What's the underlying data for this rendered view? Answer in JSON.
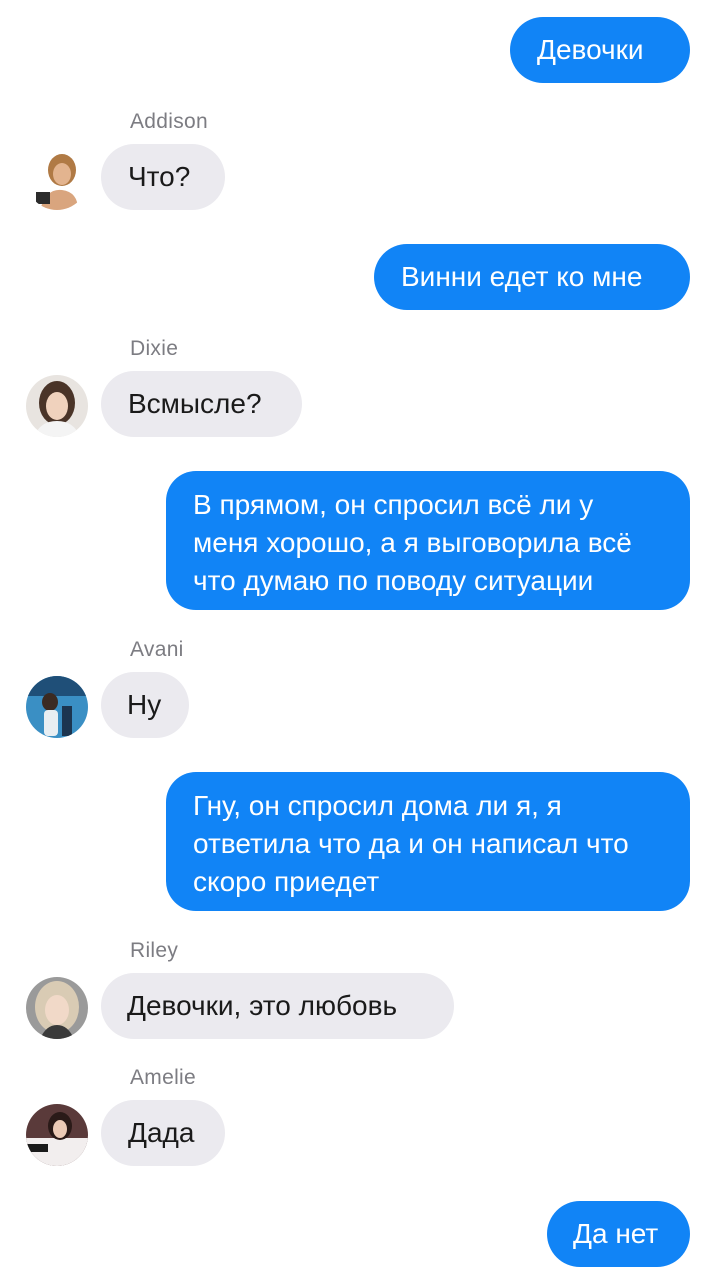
{
  "chat": {
    "messages": [
      {
        "sender": "me",
        "text": "Девочки"
      },
      {
        "sender": "Addison",
        "text": "Что?"
      },
      {
        "sender": "me",
        "text": "Винни едет ко мне"
      },
      {
        "sender": "Dixie",
        "text": "Всмысле?"
      },
      {
        "sender": "me",
        "text": "В прямом, он спросил всё ли у меня хорошо, а я выговорила всё что думаю по поводу ситуации"
      },
      {
        "sender": "Avani",
        "text": "Ну"
      },
      {
        "sender": "me",
        "text": "Гну, он спросил дома ли я, я ответила что да и он написал что скоро приедет"
      },
      {
        "sender": "Riley",
        "text": "Девочки, это любовь"
      },
      {
        "sender": "Amelie",
        "text": "Дада"
      },
      {
        "sender": "me",
        "text": "Да нет"
      }
    ]
  },
  "colors": {
    "outgoing_bubble": "#1184f6",
    "incoming_bubble": "#ebeaef",
    "name_label": "#7c7c82"
  }
}
